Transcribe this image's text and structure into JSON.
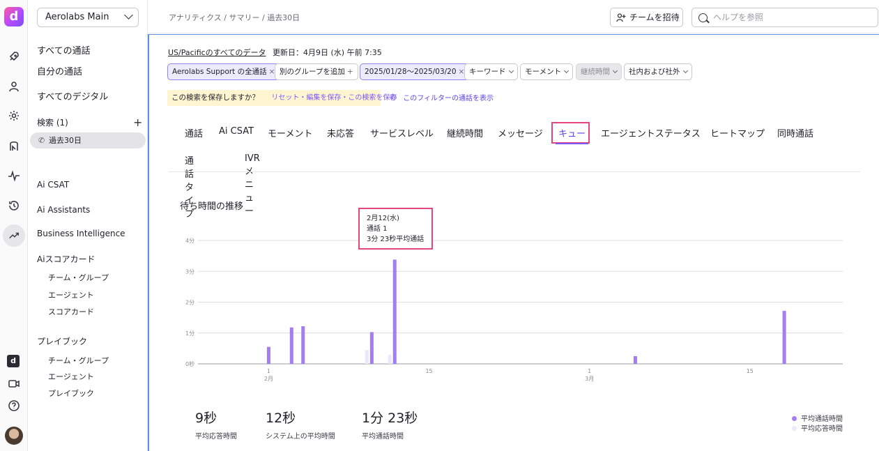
{
  "app": {
    "logo_letter": "d",
    "workspace": "Aerolabs Main"
  },
  "sidebar": {
    "items": [
      {
        "label": "すべての通話"
      },
      {
        "label": "自分の通話"
      },
      {
        "label": "すべてのデジタル"
      }
    ],
    "search_label": "検索 (1)",
    "search_item": "過去30日",
    "sections": {
      "ai_csat": "Ai CSAT",
      "ai_assistants": "Ai Assistants",
      "bi": "Business Intelligence",
      "scorecard": "Aiスコアカード",
      "scorecard_subs": [
        "チーム・グループ",
        "エージェント",
        "スコアカード"
      ],
      "playbook": "プレイブック",
      "playbook_subs": [
        "チーム・グループ",
        "エージェント",
        "プレイブック"
      ]
    }
  },
  "header": {
    "breadcrumb": "アナリティクス / サマリー / 過去30日",
    "invite_label": "チームを招待",
    "help_placeholder": "ヘルプを参照"
  },
  "filters": {
    "timezone_text": "US/Pacificのすべてのデータ",
    "updated_text": "更新日：4月9日 (水) 午前 7:35",
    "chips": [
      {
        "label": "Aerolabs Support の全通話",
        "suffix": "×",
        "state": "selected"
      },
      {
        "label": "別のグループを追加",
        "suffix": "+",
        "state": "normal"
      },
      {
        "label": "2025/01/28〜2025/03/20",
        "suffix": "×",
        "state": "selected"
      },
      {
        "label": "キーワード",
        "suffix": "chevron",
        "state": "normal"
      },
      {
        "label": "モーメント",
        "suffix": "chevron",
        "state": "normal"
      },
      {
        "label": "継続時間",
        "suffix": "chevron",
        "state": "disabled"
      },
      {
        "label": "社内および社外",
        "suffix": "chevron",
        "state": "normal"
      }
    ],
    "save_prompt": "この検索を保存しますか？",
    "save_links": "リセット・編集を保存・この検索を保存",
    "filter_calls_link": "このフィルターの通話を表示"
  },
  "tabs": {
    "row1": [
      "通話",
      "Ai CSAT",
      "モーメント",
      "未応答",
      "サービスレベル",
      "継続時間",
      "メッセージ",
      "キュー",
      "エージェントステータス",
      "ヒートマップ",
      "同時通話"
    ],
    "row2": [
      "通話タイプ",
      "IVRメニュー"
    ],
    "active": "キュー"
  },
  "chart": {
    "title": "待ち時間の推移",
    "tooltip": {
      "date": "2月12(水)",
      "calls": "通話 1",
      "avg": "3分 23秒平均通話"
    }
  },
  "chart_data": {
    "type": "bar",
    "title": "待ち時間の推移",
    "y_tick_labels": [
      "0秒",
      "1分",
      "2分",
      "3分",
      "4分"
    ],
    "ylim_minutes": [
      0,
      4
    ],
    "x_tick_labels": [
      {
        "day": "1",
        "month": "2月"
      },
      {
        "day": "15",
        "month": ""
      },
      {
        "day": "1",
        "month": "3月"
      },
      {
        "day": "15",
        "month": ""
      }
    ],
    "series": [
      {
        "name": "平均通話時間",
        "color": "#a37ef0",
        "points": [
          {
            "date": "2025-02-01",
            "value_min": 0.55
          },
          {
            "date": "2025-02-03",
            "value_min": 1.18
          },
          {
            "date": "2025-02-04",
            "value_min": 1.22
          },
          {
            "date": "2025-02-10",
            "value_min": 1.03
          },
          {
            "date": "2025-02-12",
            "value_min": 3.38
          },
          {
            "date": "2025-03-05",
            "value_min": 0.25
          },
          {
            "date": "2025-03-18",
            "value_min": 1.72
          }
        ]
      },
      {
        "name": "平均応答時間",
        "color": "#ebe8fb",
        "points": [
          {
            "date": "2025-02-10",
            "value_min": 0.45
          },
          {
            "date": "2025-02-12",
            "value_min": 0.3
          }
        ]
      }
    ],
    "grid": true,
    "legend_position": "bottom-right"
  },
  "stats": [
    {
      "value": "9秒",
      "label": "平均応答時間"
    },
    {
      "value": "12秒",
      "label": "システム上の平均時間"
    },
    {
      "value": "1分 23秒",
      "label": "平均通話時間"
    }
  ],
  "legend": [
    {
      "label": "平均通話時間",
      "color": "#a37ef0"
    },
    {
      "label": "平均応答時間",
      "color": "#ebe8fb"
    }
  ]
}
